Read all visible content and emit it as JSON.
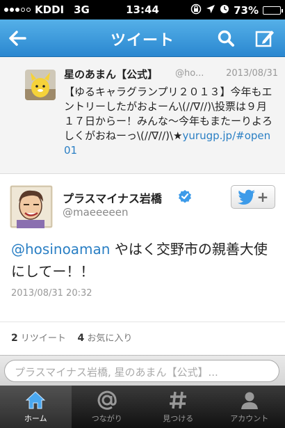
{
  "status": {
    "carrier": "KDDI",
    "network": "3G",
    "time": "13:44",
    "battery": "73%",
    "battery_level": 0.73
  },
  "nav": {
    "title": "ツイート",
    "back_icon": "back-arrow-icon",
    "search_icon": "search-icon",
    "compose_icon": "compose-icon"
  },
  "parent_tweet": {
    "name": "星のあまん【公式】",
    "handle": "@ho...",
    "date": "2013/08/31",
    "text": "【ゆるキャラグランプリ２０１３】今年もエントリーしたがおよーん\\(//∇//)\\投票は９月１７日からー！みんな〜今年もまたーりよろしくがおねーっ\\(//∇//)\\★",
    "link": "yurugp.jp/#open01"
  },
  "main_tweet": {
    "name": "プラスマイナス岩橋",
    "handle": "@maeeeeen",
    "mention": "@hosinoaman",
    "text": " やはく交野市の親善大使にしてー！！",
    "date": "2013/08/31 20:32",
    "retweets_count": "2",
    "retweets_label": "リツイート",
    "favorites_count": "4",
    "favorites_label": "お気に入り"
  },
  "reply": {
    "placeholder": "プラスマイナス岩橋, 星のあまん【公式】..."
  },
  "tabs": [
    {
      "label": "ホーム",
      "icon": "home-icon"
    },
    {
      "label": "つながり",
      "icon": "at-icon"
    },
    {
      "label": "見つける",
      "icon": "hash-icon"
    },
    {
      "label": "アカウント",
      "icon": "person-icon"
    }
  ],
  "colors": {
    "nav_blue": "#2a87d0",
    "link_blue": "#2a7fc4",
    "verified_blue": "#3d9be9"
  }
}
